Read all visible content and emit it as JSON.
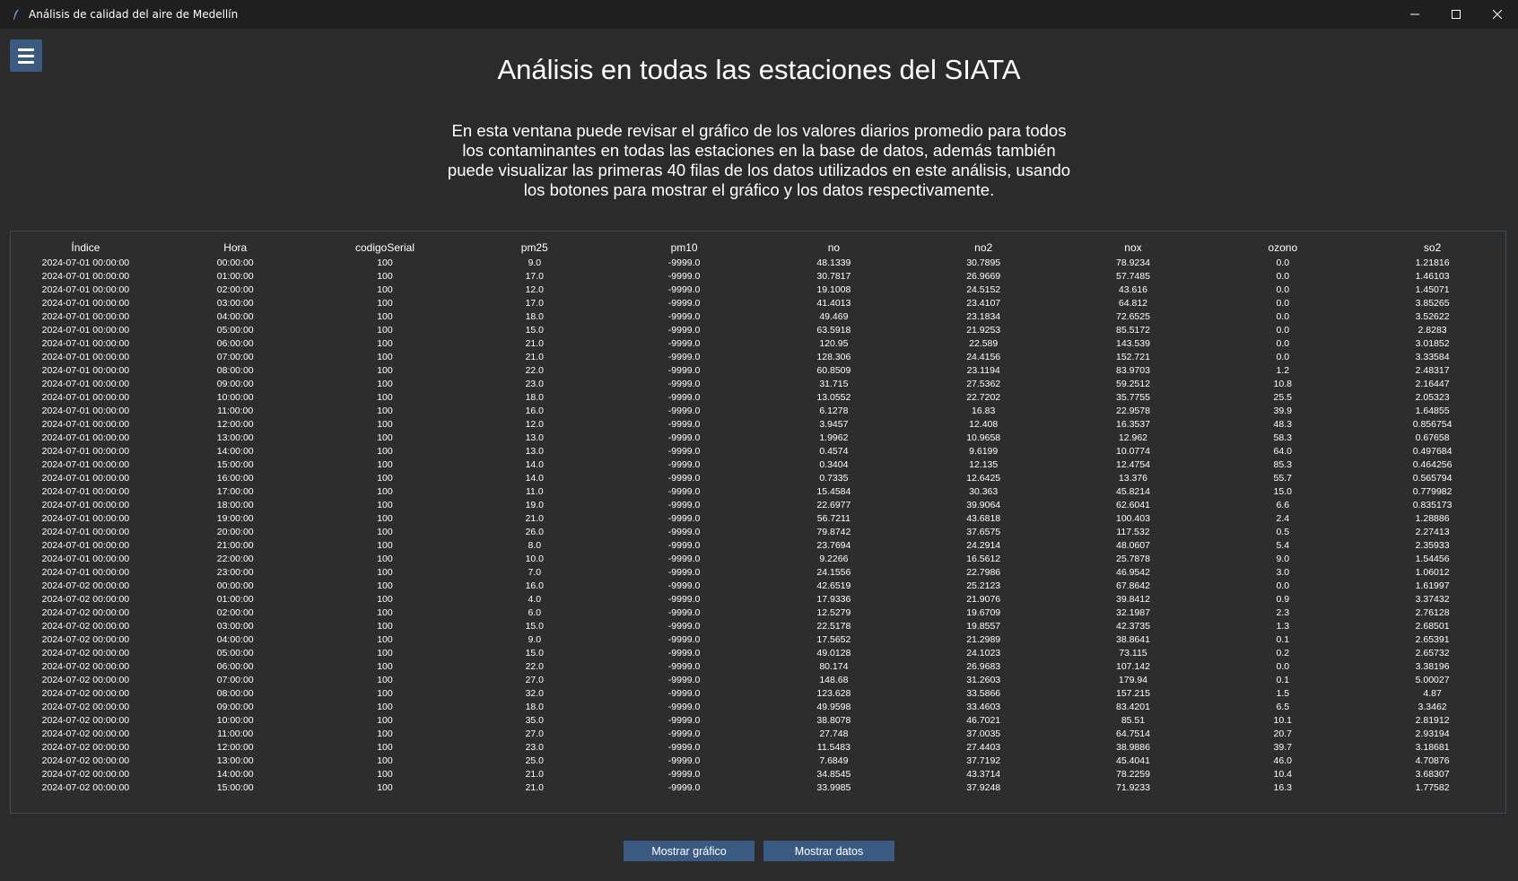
{
  "window": {
    "title": "Análisis de calidad del aire de Medellín",
    "controls": {
      "minimize": "—",
      "maximize": "☐",
      "close": "✕"
    }
  },
  "header": {
    "title": "Análisis en todas las estaciones del SIATA",
    "description": "En esta ventana puede revisar el gráfico de los valores diarios promedio para todos los contaminantes en todas las estaciones en la base de datos, además también puede visualizar las primeras 40 filas de los datos utilizados en este análisis, usando los botones para mostrar el gráfico y los datos respectivamente."
  },
  "table": {
    "columns": [
      "Índice",
      "Hora",
      "codigoSerial",
      "pm25",
      "pm10",
      "no",
      "no2",
      "nox",
      "ozono",
      "so2"
    ],
    "rows": [
      [
        "2024-07-01 00:00:00",
        "00:00:00",
        "100",
        "9.0",
        "-9999.0",
        "48.1339",
        "30.7895",
        "78.9234",
        "0.0",
        "1.21816"
      ],
      [
        "2024-07-01 00:00:00",
        "01:00:00",
        "100",
        "17.0",
        "-9999.0",
        "30.7817",
        "26.9669",
        "57.7485",
        "0.0",
        "1.46103"
      ],
      [
        "2024-07-01 00:00:00",
        "02:00:00",
        "100",
        "12.0",
        "-9999.0",
        "19.1008",
        "24.5152",
        "43.616",
        "0.0",
        "1.45071"
      ],
      [
        "2024-07-01 00:00:00",
        "03:00:00",
        "100",
        "17.0",
        "-9999.0",
        "41.4013",
        "23.4107",
        "64.812",
        "0.0",
        "3.85265"
      ],
      [
        "2024-07-01 00:00:00",
        "04:00:00",
        "100",
        "18.0",
        "-9999.0",
        "49.469",
        "23.1834",
        "72.6525",
        "0.0",
        "3.52622"
      ],
      [
        "2024-07-01 00:00:00",
        "05:00:00",
        "100",
        "15.0",
        "-9999.0",
        "63.5918",
        "21.9253",
        "85.5172",
        "0.0",
        "2.8283"
      ],
      [
        "2024-07-01 00:00:00",
        "06:00:00",
        "100",
        "21.0",
        "-9999.0",
        "120.95",
        "22.589",
        "143.539",
        "0.0",
        "3.01852"
      ],
      [
        "2024-07-01 00:00:00",
        "07:00:00",
        "100",
        "21.0",
        "-9999.0",
        "128.306",
        "24.4156",
        "152.721",
        "0.0",
        "3.33584"
      ],
      [
        "2024-07-01 00:00:00",
        "08:00:00",
        "100",
        "22.0",
        "-9999.0",
        "60.8509",
        "23.1194",
        "83.9703",
        "1.2",
        "2.48317"
      ],
      [
        "2024-07-01 00:00:00",
        "09:00:00",
        "100",
        "23.0",
        "-9999.0",
        "31.715",
        "27.5362",
        "59.2512",
        "10.8",
        "2.16447"
      ],
      [
        "2024-07-01 00:00:00",
        "10:00:00",
        "100",
        "18.0",
        "-9999.0",
        "13.0552",
        "22.7202",
        "35.7755",
        "25.5",
        "2.05323"
      ],
      [
        "2024-07-01 00:00:00",
        "11:00:00",
        "100",
        "16.0",
        "-9999.0",
        "6.1278",
        "16.83",
        "22.9578",
        "39.9",
        "1.64855"
      ],
      [
        "2024-07-01 00:00:00",
        "12:00:00",
        "100",
        "12.0",
        "-9999.0",
        "3.9457",
        "12.408",
        "16.3537",
        "48.3",
        "0.856754"
      ],
      [
        "2024-07-01 00:00:00",
        "13:00:00",
        "100",
        "13.0",
        "-9999.0",
        "1.9962",
        "10.9658",
        "12.962",
        "58.3",
        "0.67658"
      ],
      [
        "2024-07-01 00:00:00",
        "14:00:00",
        "100",
        "13.0",
        "-9999.0",
        "0.4574",
        "9.6199",
        "10.0774",
        "64.0",
        "0.497684"
      ],
      [
        "2024-07-01 00:00:00",
        "15:00:00",
        "100",
        "14.0",
        "-9999.0",
        "0.3404",
        "12.135",
        "12.4754",
        "85.3",
        "0.464256"
      ],
      [
        "2024-07-01 00:00:00",
        "16:00:00",
        "100",
        "14.0",
        "-9999.0",
        "0.7335",
        "12.6425",
        "13.376",
        "55.7",
        "0.565794"
      ],
      [
        "2024-07-01 00:00:00",
        "17:00:00",
        "100",
        "11.0",
        "-9999.0",
        "15.4584",
        "30.363",
        "45.8214",
        "15.0",
        "0.779982"
      ],
      [
        "2024-07-01 00:00:00",
        "18:00:00",
        "100",
        "19.0",
        "-9999.0",
        "22.6977",
        "39.9064",
        "62.6041",
        "6.6",
        "0.835173"
      ],
      [
        "2024-07-01 00:00:00",
        "19:00:00",
        "100",
        "21.0",
        "-9999.0",
        "56.7211",
        "43.6818",
        "100.403",
        "2.4",
        "1.28886"
      ],
      [
        "2024-07-01 00:00:00",
        "20:00:00",
        "100",
        "26.0",
        "-9999.0",
        "79.8742",
        "37.6575",
        "117.532",
        "0.5",
        "2.27413"
      ],
      [
        "2024-07-01 00:00:00",
        "21:00:00",
        "100",
        "8.0",
        "-9999.0",
        "23.7694",
        "24.2914",
        "48.0607",
        "5.4",
        "2.35933"
      ],
      [
        "2024-07-01 00:00:00",
        "22:00:00",
        "100",
        "10.0",
        "-9999.0",
        "9.2266",
        "16.5612",
        "25.7878",
        "9.0",
        "1.54456"
      ],
      [
        "2024-07-01 00:00:00",
        "23:00:00",
        "100",
        "7.0",
        "-9999.0",
        "24.1556",
        "22.7986",
        "46.9542",
        "3.0",
        "1.06012"
      ],
      [
        "2024-07-02 00:00:00",
        "00:00:00",
        "100",
        "16.0",
        "-9999.0",
        "42.6519",
        "25.2123",
        "67.8642",
        "0.0",
        "1.61997"
      ],
      [
        "2024-07-02 00:00:00",
        "01:00:00",
        "100",
        "4.0",
        "-9999.0",
        "17.9336",
        "21.9076",
        "39.8412",
        "0.9",
        "3.37432"
      ],
      [
        "2024-07-02 00:00:00",
        "02:00:00",
        "100",
        "6.0",
        "-9999.0",
        "12.5279",
        "19.6709",
        "32.1987",
        "2.3",
        "2.76128"
      ],
      [
        "2024-07-02 00:00:00",
        "03:00:00",
        "100",
        "15.0",
        "-9999.0",
        "22.5178",
        "19.8557",
        "42.3735",
        "1.3",
        "2.68501"
      ],
      [
        "2024-07-02 00:00:00",
        "04:00:00",
        "100",
        "9.0",
        "-9999.0",
        "17.5652",
        "21.2989",
        "38.8641",
        "0.1",
        "2.65391"
      ],
      [
        "2024-07-02 00:00:00",
        "05:00:00",
        "100",
        "15.0",
        "-9999.0",
        "49.0128",
        "24.1023",
        "73.115",
        "0.2",
        "2.65732"
      ],
      [
        "2024-07-02 00:00:00",
        "06:00:00",
        "100",
        "22.0",
        "-9999.0",
        "80.174",
        "26.9683",
        "107.142",
        "0.0",
        "3.38196"
      ],
      [
        "2024-07-02 00:00:00",
        "07:00:00",
        "100",
        "27.0",
        "-9999.0",
        "148.68",
        "31.2603",
        "179.94",
        "0.1",
        "5.00027"
      ],
      [
        "2024-07-02 00:00:00",
        "08:00:00",
        "100",
        "32.0",
        "-9999.0",
        "123.628",
        "33.5866",
        "157.215",
        "1.5",
        "4.87"
      ],
      [
        "2024-07-02 00:00:00",
        "09:00:00",
        "100",
        "18.0",
        "-9999.0",
        "49.9598",
        "33.4603",
        "83.4201",
        "6.5",
        "3.3462"
      ],
      [
        "2024-07-02 00:00:00",
        "10:00:00",
        "100",
        "35.0",
        "-9999.0",
        "38.8078",
        "46.7021",
        "85.51",
        "10.1",
        "2.81912"
      ],
      [
        "2024-07-02 00:00:00",
        "11:00:00",
        "100",
        "27.0",
        "-9999.0",
        "27.748",
        "37.0035",
        "64.7514",
        "20.7",
        "2.93194"
      ],
      [
        "2024-07-02 00:00:00",
        "12:00:00",
        "100",
        "23.0",
        "-9999.0",
        "11.5483",
        "27.4403",
        "38.9886",
        "39.7",
        "3.18681"
      ],
      [
        "2024-07-02 00:00:00",
        "13:00:00",
        "100",
        "25.0",
        "-9999.0",
        "7.6849",
        "37.7192",
        "45.4041",
        "46.0",
        "4.70876"
      ],
      [
        "2024-07-02 00:00:00",
        "14:00:00",
        "100",
        "21.0",
        "-9999.0",
        "34.8545",
        "43.3714",
        "78.2259",
        "10.4",
        "3.68307"
      ],
      [
        "2024-07-02 00:00:00",
        "15:00:00",
        "100",
        "21.0",
        "-9999.0",
        "33.9985",
        "37.9248",
        "71.9233",
        "16.3",
        "1.77582"
      ]
    ]
  },
  "buttons": {
    "show_chart": "Mostrar gráfico",
    "show_data": "Mostrar datos"
  },
  "colors": {
    "background": "#2b2b2b",
    "titlebar": "#1f1f1f",
    "button": "#3a5a82",
    "text": "#ffffff"
  },
  "icons": {
    "app": "feather-icon",
    "menu": "hamburger-menu-icon"
  }
}
